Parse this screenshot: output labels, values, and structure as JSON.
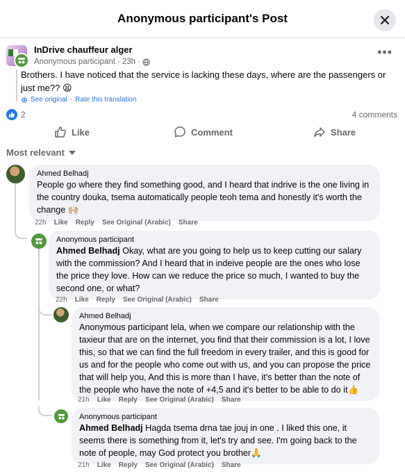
{
  "header": {
    "title": "Anonymous participant's Post"
  },
  "post": {
    "group_name": "InDrive chauffeur alger",
    "author": "Anonymous participant",
    "time": "23h",
    "separator": "·",
    "text": "Brothers. I have noticed that the service is lacking these days, where are the passengers or just me?? 😫",
    "see_original": "See original",
    "rate_translation": "Rate this translation",
    "translate_sep": "·",
    "like_count": "2",
    "comments_count": "4 comments"
  },
  "actions": {
    "like": "Like",
    "comment": "Comment",
    "share": "Share"
  },
  "sort": {
    "label": "Most relevant"
  },
  "comments": [
    {
      "author": "Ahmed Belhadj",
      "mention": "",
      "text": "People go where they find something good, and I heard that indrive is the one living in the country douka, tsema automatically people teoh tema and honestly it's worth the change 🙌🏼",
      "time": "22h",
      "like": "Like",
      "reply": "Reply",
      "see_original": "See Original (Arabic)",
      "share": "Share"
    },
    {
      "author": "Anonymous participant",
      "mention": "Ahmed Belhadj",
      "text": " Okay, what are you going to help us to keep cutting our salary with the commission? And I heard that in indeive people are the ones who lose the price they love. How can we reduce the price so much, I wanted to buy the second one, or what?",
      "time": "22h",
      "like": "Like",
      "reply": "Reply",
      "see_original": "See Original (Arabic)",
      "share": "Share"
    },
    {
      "author": "Ahmed Belhadj",
      "mention": "",
      "text": "Anonymous participant lela, when we compare our relationship with the taxieur that are on the internet, you find that their commission is a lot, I love this, so that we can find the full freedom in every trailer, and this is good for us and for the people who come out with us, and you can propose the price that will help you, And this is more than I have, it's better than the note of the people who have the note of +4,5 and it's better to be able to do it👍",
      "time": "21h",
      "like": "Like",
      "reply": "Reply",
      "see_original": "See Original (Arabic)",
      "share": "Share"
    },
    {
      "author": "Anonymous participant",
      "mention": "Ahmed Belhadj",
      "text": " Hagda tsema drna tae jouj in one . I liked this one, it seems there is something from it, let's try and see. I'm going back to the note of people, may God protect you brother🙏",
      "time": "21h",
      "like": "Like",
      "reply": "Reply",
      "see_original": "See Original (Arabic)",
      "share": "Share"
    }
  ],
  "colors": {
    "link": "#216fdb",
    "like_blue": "#1877f2",
    "anon_green": "#4f9b3a",
    "bubble": "#f0f2f5",
    "muted": "#65676b"
  }
}
